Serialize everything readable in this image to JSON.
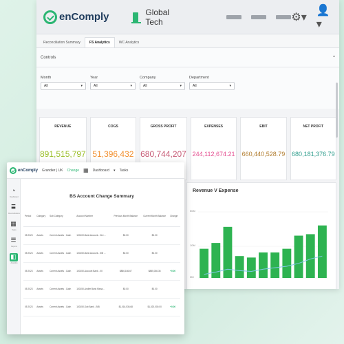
{
  "app": {
    "logo": "enComply",
    "company": "Global Tech"
  },
  "tabs": [
    "Reconciliation Summary",
    "FS Analytics",
    "WC Analytics"
  ],
  "controls": {
    "title": "Controls",
    "filters": [
      {
        "label": "Month",
        "value": "All"
      },
      {
        "label": "Year",
        "value": "All"
      },
      {
        "label": "Company",
        "value": "All"
      },
      {
        "label": "Department",
        "value": "All"
      }
    ]
  },
  "kpis": [
    {
      "label": "REVENUE",
      "value": "891,515,797",
      "color": "#9bbf2a"
    },
    {
      "label": "COGS",
      "value": "51,396,432",
      "color": "#f2902f"
    },
    {
      "label": "GROSS PROFIT",
      "value": "680,744,207",
      "color": "#c65a75"
    },
    {
      "label": "EXPENSES",
      "value": "244,112,674.21",
      "color": "#e44c8f"
    },
    {
      "label": "EBIT",
      "value": "660,440,528.79",
      "color": "#b07b2c"
    },
    {
      "label": "NET PROFIT",
      "value": "680,181,376.79",
      "color": "#2e9c8c"
    }
  ],
  "chart_data": {
    "type": "bar",
    "title": "Revenue V Expense",
    "y_tick_labels": [
      "50M",
      "10M",
      "0M"
    ],
    "series": [
      {
        "type": "bar",
        "color": "#2eb351",
        "values": [
          40,
          48,
          70,
          30,
          28,
          35,
          35,
          40,
          58,
          60,
          72
        ]
      },
      {
        "type": "line",
        "color": "#7fc8e8",
        "values": [
          5,
          8,
          12,
          10,
          9,
          12,
          14,
          16,
          20,
          26,
          30
        ]
      }
    ]
  },
  "front": {
    "logo": "enComply",
    "breadcrumb": "Grandier | UK",
    "change": "Change",
    "dashboard": "Dashboard",
    "tasks": "Tasks",
    "sidebar": [
      "Dashboard",
      "Reconciliations",
      "Tasks",
      "Reports",
      "Analytics"
    ],
    "title": "BS Account Change Summary",
    "columns": [
      "Period",
      "Category",
      "Sub Category",
      "Account Number",
      "Previous Month Balance",
      "Current Month Balance",
      "Change"
    ],
    "rows": [
      [
        "05 2023",
        "Assets",
        "Current Assets - Cash",
        "100100-Bank Account - 0L4 ...",
        "$0.00",
        "$0.00",
        ""
      ],
      [
        "05 2023",
        "Assets",
        "Current Assets - Cash",
        "100150-Bank Account - 5IB ...",
        "$0.00",
        "$0.00",
        ""
      ],
      [
        "05 2023",
        "Assets",
        "Current Assets - Cash",
        "100150-Account Bank - IIII",
        "$886,166.67",
        "$885,036.36",
        "+0.00"
      ],
      [
        "05 2023",
        "Assets",
        "Current Assets - Cash",
        "100150-Andler Bank Mana...",
        "$0.00",
        "$0.00",
        ""
      ],
      [
        "05 2023",
        "Assets",
        "Current Assets - Cash",
        "100150-Sub Bank - BIB",
        "$1,016,536.68",
        "$1,020,000.00",
        "+0.00"
      ]
    ]
  }
}
